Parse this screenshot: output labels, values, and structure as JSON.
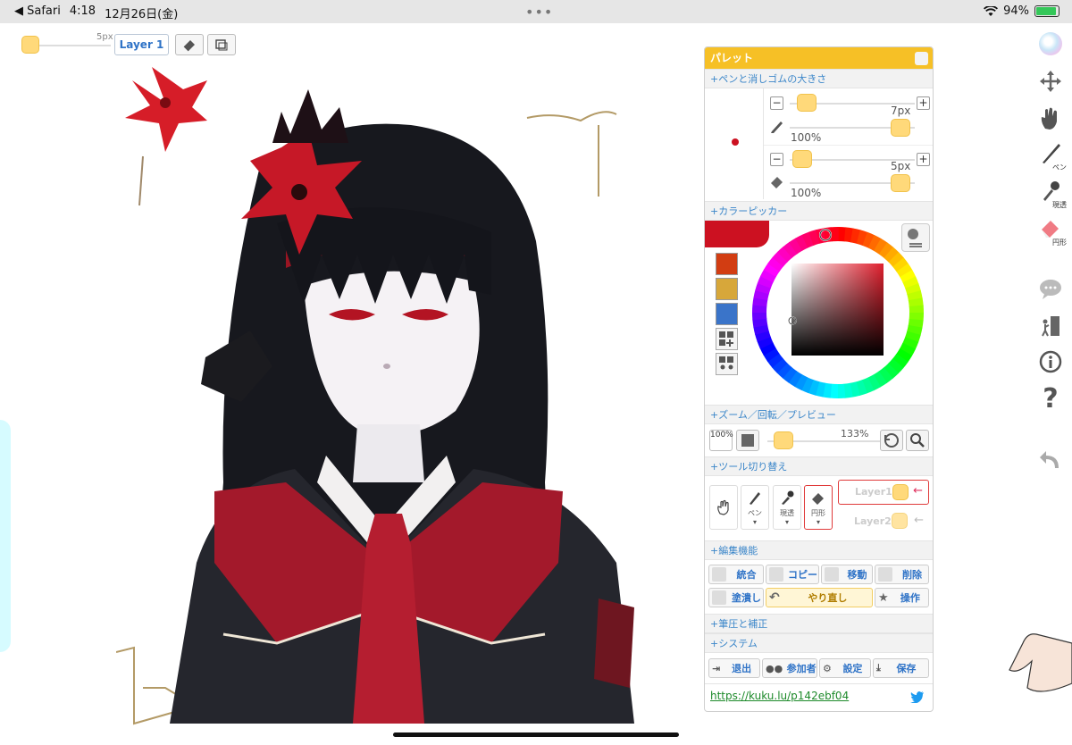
{
  "statusbar": {
    "back_app": "◀ Safari",
    "time": "4:18",
    "date": "12月26日(金)",
    "battery": "94%"
  },
  "topbar": {
    "brush_size": "5px",
    "layer_label": "Layer 1"
  },
  "palette": {
    "title": "パレット",
    "sections": {
      "pen_size": "+ペンと消しゴムの大きさ",
      "color_picker": "+カラーピッカー",
      "zoom": "+ズーム／回転／プレビュー",
      "tool_switch": "+ツール切り替え",
      "edit": "+編集機能",
      "pressure": "+筆圧と補正",
      "system": "+システム"
    },
    "pen": {
      "size": "7px",
      "opacity": "100%",
      "size_level": 0.1,
      "opacity_level": 1.0
    },
    "eraser": {
      "size": "5px",
      "opacity": "100%",
      "size_level": 0.07,
      "opacity_level": 1.0
    },
    "colors": {
      "current": "#cc1121",
      "swatches": [
        "#d23d12",
        "#d7a73a",
        "#3a74c9"
      ]
    },
    "zoom": {
      "percent_button": "100%",
      "zoom_level": "133%"
    },
    "tools": [
      {
        "name": "hand",
        "label": ""
      },
      {
        "name": "pen",
        "label": "ペン"
      },
      {
        "name": "dropper",
        "label": "現透"
      },
      {
        "name": "eraser",
        "label": "円形"
      }
    ],
    "layers": [
      "Layer1",
      "Layer2"
    ],
    "edit_buttons": {
      "merge": "統合",
      "copy": "コピー",
      "move": "移動",
      "delete": "削除",
      "fill": "塗潰し",
      "redo": "やり直し",
      "operate": "操作"
    },
    "system_buttons": {
      "exit": "退出",
      "participants": "参加者",
      "settings": "設定",
      "save": "保存"
    },
    "link": "https://kuku.lu/p142ebf04"
  },
  "sidebar": {
    "pen_label": "ペン",
    "dropper_label": "現透",
    "eraser_label": "円形"
  }
}
